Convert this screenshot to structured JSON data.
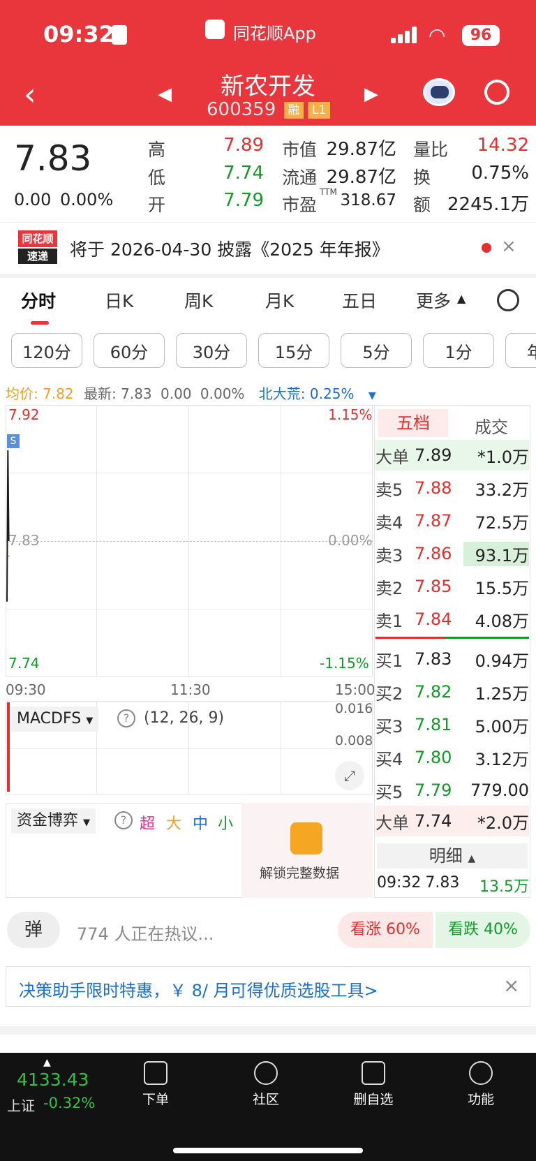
{
  "status": {
    "time": "09:32",
    "app": "同花顺App",
    "battery": "96"
  },
  "nav": {
    "stock_name": "新农开发",
    "code": "600359",
    "badge_rong": "融",
    "badge_l1": "L1"
  },
  "quote": {
    "price": "7.83",
    "change": "0.00",
    "change_pct": "0.00%",
    "high_label": "高",
    "high": "7.89",
    "low_label": "低",
    "low": "7.74",
    "open_label": "开",
    "open": "7.79",
    "mktcap_label": "市值",
    "mktcap": "29.87亿",
    "float_label": "流通",
    "float": "29.87亿",
    "pe_label": "市盈",
    "pe_sup": "TTM",
    "pe": "318.67",
    "volratio_label": "量比",
    "volratio": "14.32",
    "turnover_label": "换",
    "turnover": "0.75%",
    "amount_label": "额",
    "amount": "2245.1万"
  },
  "news": {
    "logo_top": "同花顺",
    "logo_bottom": "速递",
    "text": "将于 2026-04-30 披露《2025 年年报》"
  },
  "tabs": [
    "分时",
    "日K",
    "周K",
    "月K",
    "五日",
    "更多"
  ],
  "periods": [
    "120分",
    "60分",
    "30分",
    "15分",
    "5分",
    "1分",
    "年"
  ],
  "info_line": {
    "avg_label": "均价:",
    "avg": "7.82",
    "latest_label": "最新:",
    "latest": "7.83",
    "chg": "0.00",
    "pct": "0.00%",
    "peer_label": "北大荒:",
    "peer": "0.25%"
  },
  "chart": {
    "y_top_left": "7.92",
    "y_mid_left": "7.83",
    "y_bot_left": "7.74",
    "y_top_right": "1.15%",
    "y_mid_right": "0.00%",
    "y_bot_right": "-1.15%",
    "x_start": "09:30",
    "x_mid": "11:30",
    "x_end": "15:00",
    "marker": "S",
    "chart_data": {
      "type": "line",
      "title": "",
      "x": [
        "09:30",
        "09:31",
        "09:32"
      ],
      "series": [
        {
          "name": "",
          "values": [
            7.79,
            7.89,
            7.83
          ]
        }
      ],
      "ylim": [
        7.74,
        7.92
      ]
    }
  },
  "orderbook": {
    "tab_five": "五档",
    "tab_deal": "成交",
    "big_sell": {
      "label": "大单",
      "price": "7.89",
      "vol": "*1.0万"
    },
    "asks": [
      {
        "label": "卖5",
        "price": "7.88",
        "vol": "33.2万"
      },
      {
        "label": "卖4",
        "price": "7.87",
        "vol": "72.5万"
      },
      {
        "label": "卖3",
        "price": "7.86",
        "vol": "93.1万"
      },
      {
        "label": "卖2",
        "price": "7.85",
        "vol": "15.5万"
      },
      {
        "label": "卖1",
        "price": "7.84",
        "vol": "4.08万"
      }
    ],
    "bids": [
      {
        "label": "买1",
        "price": "7.83",
        "vol": "0.94万"
      },
      {
        "label": "买2",
        "price": "7.82",
        "vol": "1.25万"
      },
      {
        "label": "买3",
        "price": "7.81",
        "vol": "5.00万"
      },
      {
        "label": "买4",
        "price": "7.80",
        "vol": "3.12万"
      },
      {
        "label": "买5",
        "price": "7.79",
        "vol": "779.00"
      }
    ],
    "big_buy": {
      "label": "大单",
      "price": "7.74",
      "vol": "*2.0万"
    },
    "detail_label": "明细",
    "detail_row": {
      "time": "09:32",
      "price": "7.83",
      "vol": "13.5万"
    }
  },
  "macd": {
    "name": "MACDFS",
    "params": "(12, 26, 9)",
    "v1": "0.016",
    "v2": "0.008"
  },
  "fund": {
    "name": "资金博弈",
    "super": "超",
    "big": "大",
    "mid": "中",
    "small": "小",
    "unlock": "解锁完整数据"
  },
  "comment": {
    "danmu": "弹",
    "count_text": "774 人正在热议...",
    "up": "看涨 60%",
    "down": "看跌 40%"
  },
  "promo": {
    "text": "决策助手限时特惠，￥ 8/ 月可得优质选股工具>"
  },
  "bottom": {
    "index_value": "4133.43",
    "index_name": "上证",
    "index_chg": "-0.32%",
    "tabs": [
      "下单",
      "社区",
      "删自选",
      "功能"
    ]
  }
}
